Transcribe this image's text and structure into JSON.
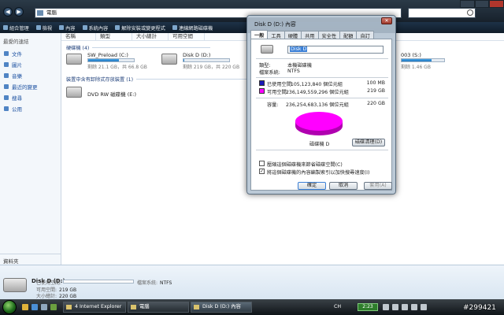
{
  "explorer": {
    "address": "電腦",
    "toolbar": [
      "組合管理",
      "檢視",
      "內容",
      "系統內容",
      "解除安裝或變更程式",
      "連線網路磁碟機"
    ],
    "columns": [
      "名稱",
      "類型",
      "大小總計",
      "可用空間"
    ],
    "sidebar_header": "最愛的連結",
    "sidebar_items": [
      "文件",
      "圖片",
      "音樂",
      "最近的變更",
      "搜尋",
      "公用"
    ],
    "folders_label": "資料夾",
    "group_hdd": "硬碟機 (4)",
    "group_removable": "裝置中含有卸除式存放裝置 (1)",
    "drives": [
      {
        "name": "SW_Preload (C:)",
        "free": "剩餘 21.1 GB，共 66.8 GB",
        "used_fraction": 0.68
      },
      {
        "name": "Disk D (D:)",
        "free": "剩餘 219 GB，共 220 GB",
        "used_fraction": 0.01
      },
      {
        "name": "003 (S:)",
        "free": "剩餘 1.46 GB",
        "used_fraction": 0.7
      }
    ],
    "dvd": "DVD RW 磁碟機 (E:)",
    "details": {
      "name": "Disk D (D:)",
      "used_label": "已使用空間:",
      "free_label": "可用空間:",
      "free_value": "219 GB",
      "total_label": "大小總計:",
      "total_value": "220 GB",
      "fs_label": "檔案系統:",
      "fs_value": "NTFS"
    }
  },
  "dialog": {
    "title": "Disk D (D:) 內容",
    "tabs": [
      "一般",
      "工具",
      "硬體",
      "共用",
      "安全性",
      "配額",
      "自訂"
    ],
    "name_value": "Disk D",
    "type_label": "類型:",
    "type_value": "本機磁碟機",
    "fs_label": "檔案系統:",
    "fs_value": "NTFS",
    "used_label": "已使用空間:",
    "used_bytes": "105,123,840 個位元組",
    "used_gb": "100 MB",
    "free_label": "可用空間:",
    "free_bytes": "236,149,559,296 個位元組",
    "free_gb": "219 GB",
    "capacity_label": "容量:",
    "capacity_bytes": "236,254,683,136 個位元組",
    "capacity_gb": "220 GB",
    "drive_label": "磁碟機 D",
    "cleanup_button": "磁碟清理(D)",
    "compress_label": "壓縮這個磁碟機來節省磁碟空間(C)",
    "index_label": "將這個磁碟機的內容編製索引以加快搜尋速度(I)",
    "index_checked": true,
    "ok": "確定",
    "cancel": "取消",
    "apply": "套用(A)",
    "used_color": "#1a1ab8",
    "free_color": "#ff00ff"
  },
  "taskbar": {
    "tasks": [
      "4 Internet Explorer",
      "電腦",
      "Disk D (D:) 內容"
    ],
    "lang": "CH",
    "badge": "2:23"
  },
  "watermark": "#299421"
}
